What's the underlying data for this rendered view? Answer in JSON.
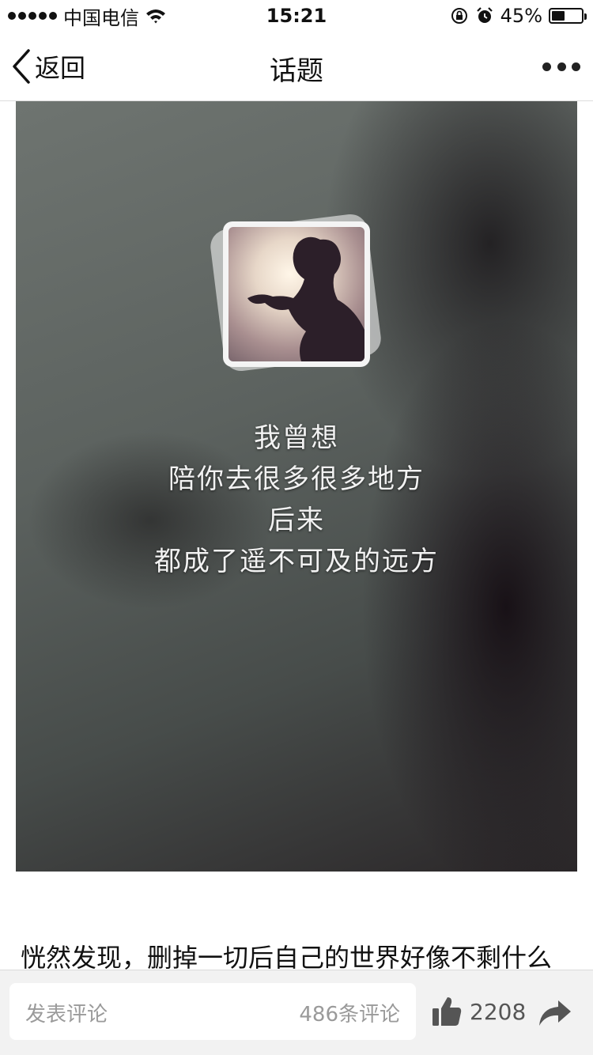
{
  "status_bar": {
    "carrier": "中国电信",
    "time": "15:21",
    "battery_percent": "45%",
    "battery_level": 0.45,
    "icons": [
      "signal-dots",
      "wifi-icon",
      "rotation-lock-icon",
      "alarm-icon",
      "battery-icon"
    ]
  },
  "nav": {
    "back_label": "返回",
    "title": "话题",
    "more_icon": "more-dots-icon"
  },
  "post": {
    "image_text": [
      "我曾想",
      "陪你去很多很多地方",
      "后来",
      "都成了遥不可及的远方"
    ],
    "body_text": "恍然发现，删掉一切后自己的世界好像不剩什么"
  },
  "bottom_bar": {
    "comment_placeholder": "发表评论",
    "comment_count": "486条评论",
    "like_count": "2208",
    "like_icon": "thumbs-up-icon",
    "share_icon": "share-arrow-icon"
  },
  "colors": {
    "background": "#ffffff",
    "bottom_bar": "#f2f2f2",
    "placeholder": "#9a9a9a",
    "icon_gray": "#555555"
  }
}
